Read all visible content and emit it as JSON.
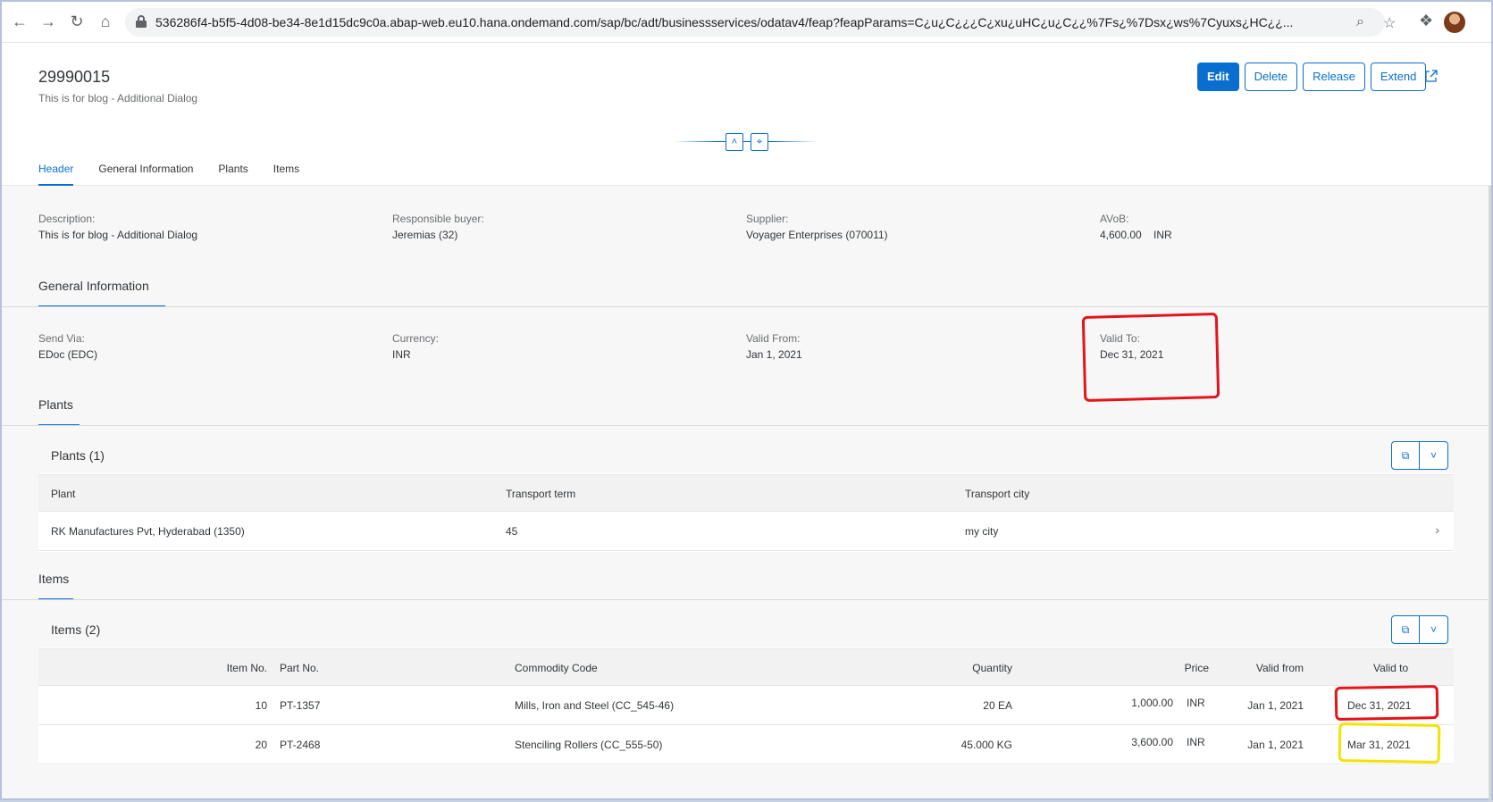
{
  "browser": {
    "url": "536286f4-b5f5-4d08-be34-8e1d15dc9c0a.abap-web.eu10.hana.ondemand.com/sap/bc/adt/businessservices/odatav4/feap?feapParams=C¿u¿C¿¿¿C¿xu¿uHC¿u¿C¿¿%7Fs¿%7Dsx¿ws%7Cyuxs¿HC¿¿..."
  },
  "header": {
    "title": "29990015",
    "subtitle": "This is for blog - Additional Dialog",
    "actions": {
      "edit": "Edit",
      "delete": "Delete",
      "release": "Release",
      "extend": "Extend"
    }
  },
  "tabs": [
    "Header",
    "General Information",
    "Plants",
    "Items"
  ],
  "header_fields": [
    {
      "label": "Description:",
      "value": "This is for blog - Additional Dialog"
    },
    {
      "label": "Responsible buyer:",
      "value": "Jeremias (32)"
    },
    {
      "label": "Supplier:",
      "value": "Voyager Enterprises (070011)"
    },
    {
      "label": "AVoB:",
      "value": "4,600.00    INR"
    }
  ],
  "general_info": {
    "title": "General Information",
    "fields": [
      {
        "label": "Send Via:",
        "value": "EDoc (EDC)"
      },
      {
        "label": "Currency:",
        "value": "INR"
      },
      {
        "label": "Valid From:",
        "value": "Jan 1, 2021"
      },
      {
        "label": "Valid To:",
        "value": "Dec 31, 2021"
      }
    ]
  },
  "plants": {
    "section_title": "Plants",
    "table_title": "Plants (1)",
    "columns": [
      "Plant",
      "Transport term",
      "Transport city"
    ],
    "rows": [
      {
        "plant": "RK Manufactures Pvt, Hyderabad (1350)",
        "term": "45",
        "city": "my city"
      }
    ]
  },
  "items": {
    "section_title": "Items",
    "table_title": "Items (2)",
    "columns": [
      "Item No.",
      "Part No.",
      "Commodity Code",
      "Quantity",
      "Price",
      "Valid from",
      "Valid to"
    ],
    "rows": [
      {
        "item_no": "10",
        "part_no": "PT-1357",
        "commodity": "Mills, Iron and Steel (CC_545-46)",
        "quantity": "20 EA",
        "price": "1,000.00",
        "currency": "INR",
        "valid_from": "Jan 1, 2021",
        "valid_to": "Dec 31, 2021"
      },
      {
        "item_no": "20",
        "part_no": "PT-2468",
        "commodity": "Stenciling Rollers (CC_555-50)",
        "quantity": "45.000 KG",
        "price": "3,600.00",
        "currency": "INR",
        "valid_from": "Jan 1, 2021",
        "valid_to": "Mar 31, 2021"
      }
    ]
  },
  "icons": {
    "back": "←",
    "forward": "→",
    "reload": "↻",
    "home": "⌂",
    "zoom": "⌕",
    "star": "☆",
    "puzzle": "❖",
    "collapse": "˄",
    "pin": "⌖",
    "copy": "⧉",
    "dropdown": "˅",
    "chevron": "›"
  },
  "colors": {
    "accent": "#0a6ed1",
    "annotation_red": "#e5131a",
    "annotation_yellow": "#f4e200"
  }
}
